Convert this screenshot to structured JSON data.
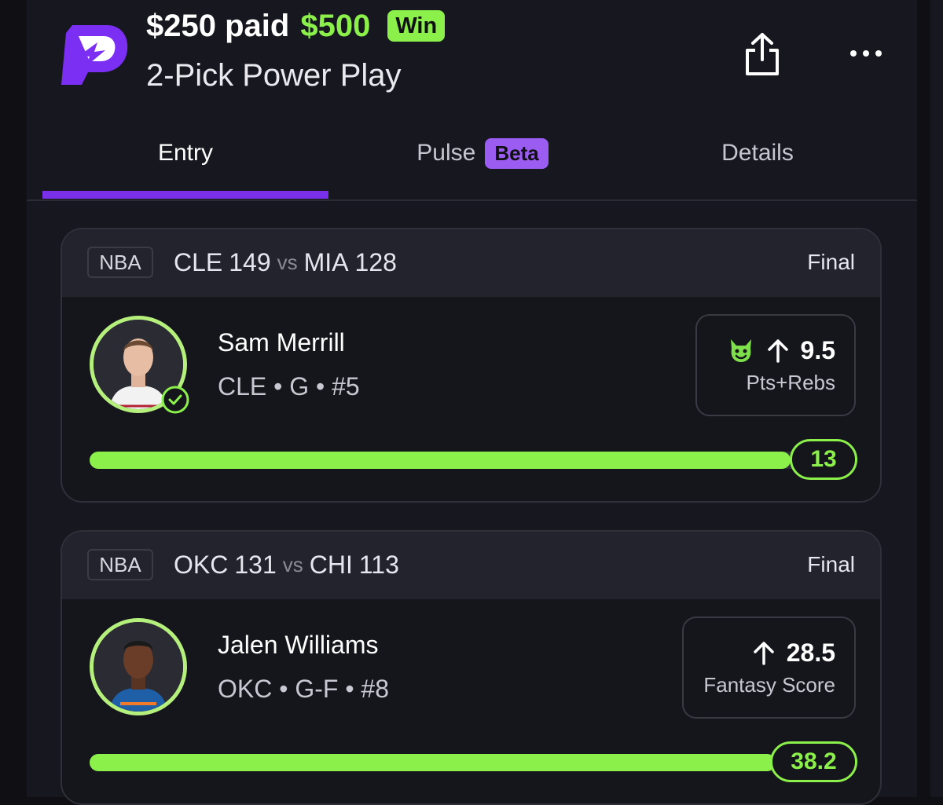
{
  "header": {
    "stake": "$250 paid",
    "payout": "$500",
    "result_badge": "Win",
    "entry_type": "2-Pick Power Play",
    "brand_icon": "prizepicks-logo",
    "share_icon": "share-icon",
    "more_icon": "more-options-icon"
  },
  "tabs": [
    {
      "label": "Entry",
      "active": true
    },
    {
      "label": "Pulse",
      "badge": "Beta",
      "active": false
    },
    {
      "label": "Details",
      "active": false
    }
  ],
  "picks": [
    {
      "league": "NBA",
      "home_team": "CLE",
      "home_score": "149",
      "vs": "vs",
      "away_team": "MIA",
      "away_score": "128",
      "status": "Final",
      "player_name": "Sam Merrill",
      "player_meta": "CLE • G • #5",
      "direction": "more",
      "line": "9.5",
      "stat": "Pts+Rebs",
      "result": "13",
      "progress_pct": 92,
      "has_demon_icon": true,
      "has_check": true
    },
    {
      "league": "NBA",
      "home_team": "OKC",
      "home_score": "131",
      "vs": "vs",
      "away_team": "CHI",
      "away_score": "113",
      "status": "Final",
      "player_name": "Jalen Williams",
      "player_meta": "OKC • G-F • #8",
      "direction": "more",
      "line": "28.5",
      "stat": "Fantasy Score",
      "result": "38.2",
      "progress_pct": 90,
      "has_demon_icon": false,
      "has_check": false
    }
  ],
  "colors": {
    "accent_green": "#8cf04a",
    "accent_purple": "#7a2fe8",
    "beta_purple": "#9b5cf2",
    "background": "#0f0f14"
  }
}
